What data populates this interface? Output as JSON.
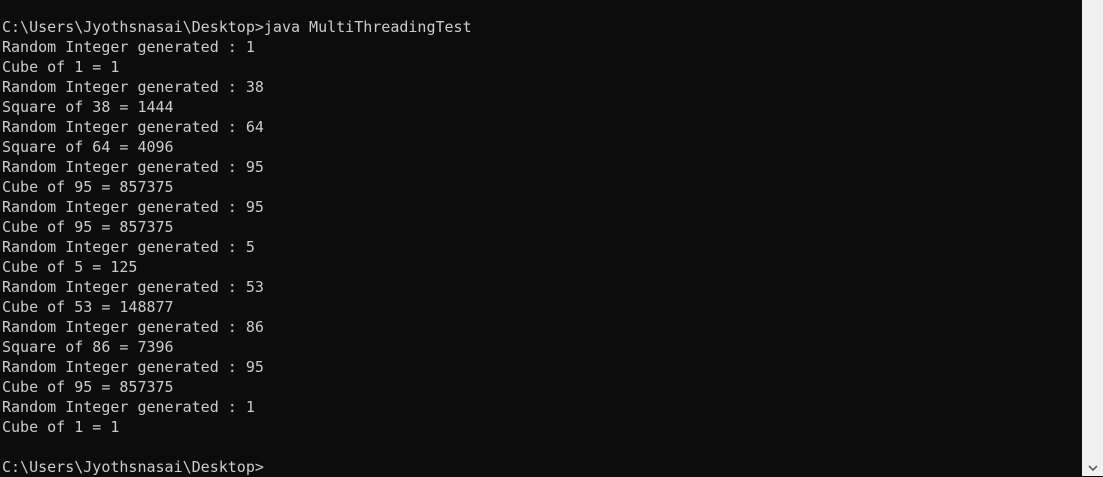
{
  "console": {
    "lines": [
      "C:\\Users\\Jyothsnasai\\Desktop>java MultiThreadingTest",
      "Random Integer generated : 1",
      "Cube of 1 = 1",
      "Random Integer generated : 38",
      "Square of 38 = 1444",
      "Random Integer generated : 64",
      "Square of 64 = 4096",
      "Random Integer generated : 95",
      "Cube of 95 = 857375",
      "Random Integer generated : 95",
      "Cube of 95 = 857375",
      "Random Integer generated : 5",
      "Cube of 5 = 125",
      "Random Integer generated : 53",
      "Cube of 53 = 148877",
      "Random Integer generated : 86",
      "Square of 86 = 7396",
      "Random Integer generated : 95",
      "Cube of 95 = 857375",
      "Random Integer generated : 1",
      "Cube of 1 = 1",
      "",
      "C:\\Users\\Jyothsnasai\\Desktop>"
    ]
  },
  "colors": {
    "background": "#0c0c0c",
    "text": "#cccccc",
    "scrollbar": "#f0f0f0"
  }
}
